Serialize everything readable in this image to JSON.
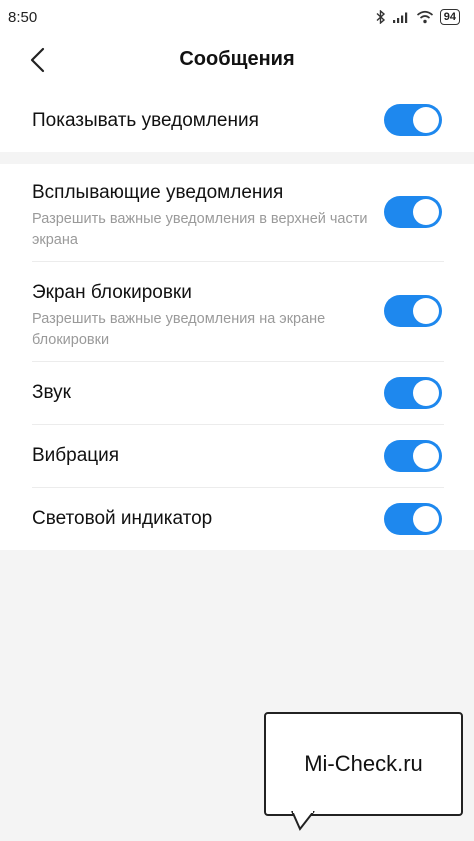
{
  "status_bar": {
    "time": "8:50",
    "battery": "94",
    "icons": [
      "bluetooth-icon",
      "signal-icon",
      "wifi-icon",
      "battery-icon"
    ]
  },
  "header": {
    "title": "Сообщения",
    "back_icon": "chevron-left-icon"
  },
  "settings": {
    "show_notifications": {
      "label": "Показывать уведомления",
      "enabled": true
    },
    "popup": {
      "label": "Всплывающие уведомления",
      "sub": "Разрешить важные уведомления в верхней части экрана",
      "enabled": true
    },
    "lock_screen": {
      "label": "Экран блокировки",
      "sub": "Разрешить важные уведомления на экране блокировки",
      "enabled": true
    },
    "sound": {
      "label": "Звук",
      "enabled": true
    },
    "vibration": {
      "label": "Вибрация",
      "enabled": true
    },
    "led": {
      "label": "Световой индикатор",
      "enabled": true
    }
  },
  "watermark": {
    "text": "Mi-Check.ru"
  },
  "colors": {
    "toggle_on": "#1e88ee",
    "background": "#f4f4f4",
    "secondary_text": "#9a9a9a"
  }
}
